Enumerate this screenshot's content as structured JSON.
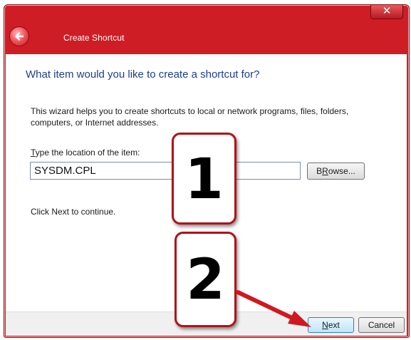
{
  "window": {
    "title": "Create Shortcut",
    "close_glyph": "✕"
  },
  "wizard": {
    "heading": "What item would you like to create a shortcut for?",
    "description": "This wizard helps you to create shortcuts to local or network programs, files, folders, computers, or Internet addresses.",
    "field_label_accel": "T",
    "field_label_rest": "ype the location of the item:",
    "location_value": "SYSDM.CPL",
    "browse_accel": "R",
    "browse_pre": "B",
    "browse_post": "owse...",
    "hint": "Click Next to continue."
  },
  "footer": {
    "next_accel": "N",
    "next_rest": "ext",
    "cancel_label": "Cancel"
  },
  "callouts": {
    "step1": "1",
    "step2": "2"
  },
  "colors": {
    "frame": "#cf1d25",
    "heading": "#1d3d8f",
    "callout_border": "#b11219",
    "arrow": "#d0181f"
  },
  "icons": {
    "back": "back-arrow-icon",
    "close": "close-icon"
  }
}
